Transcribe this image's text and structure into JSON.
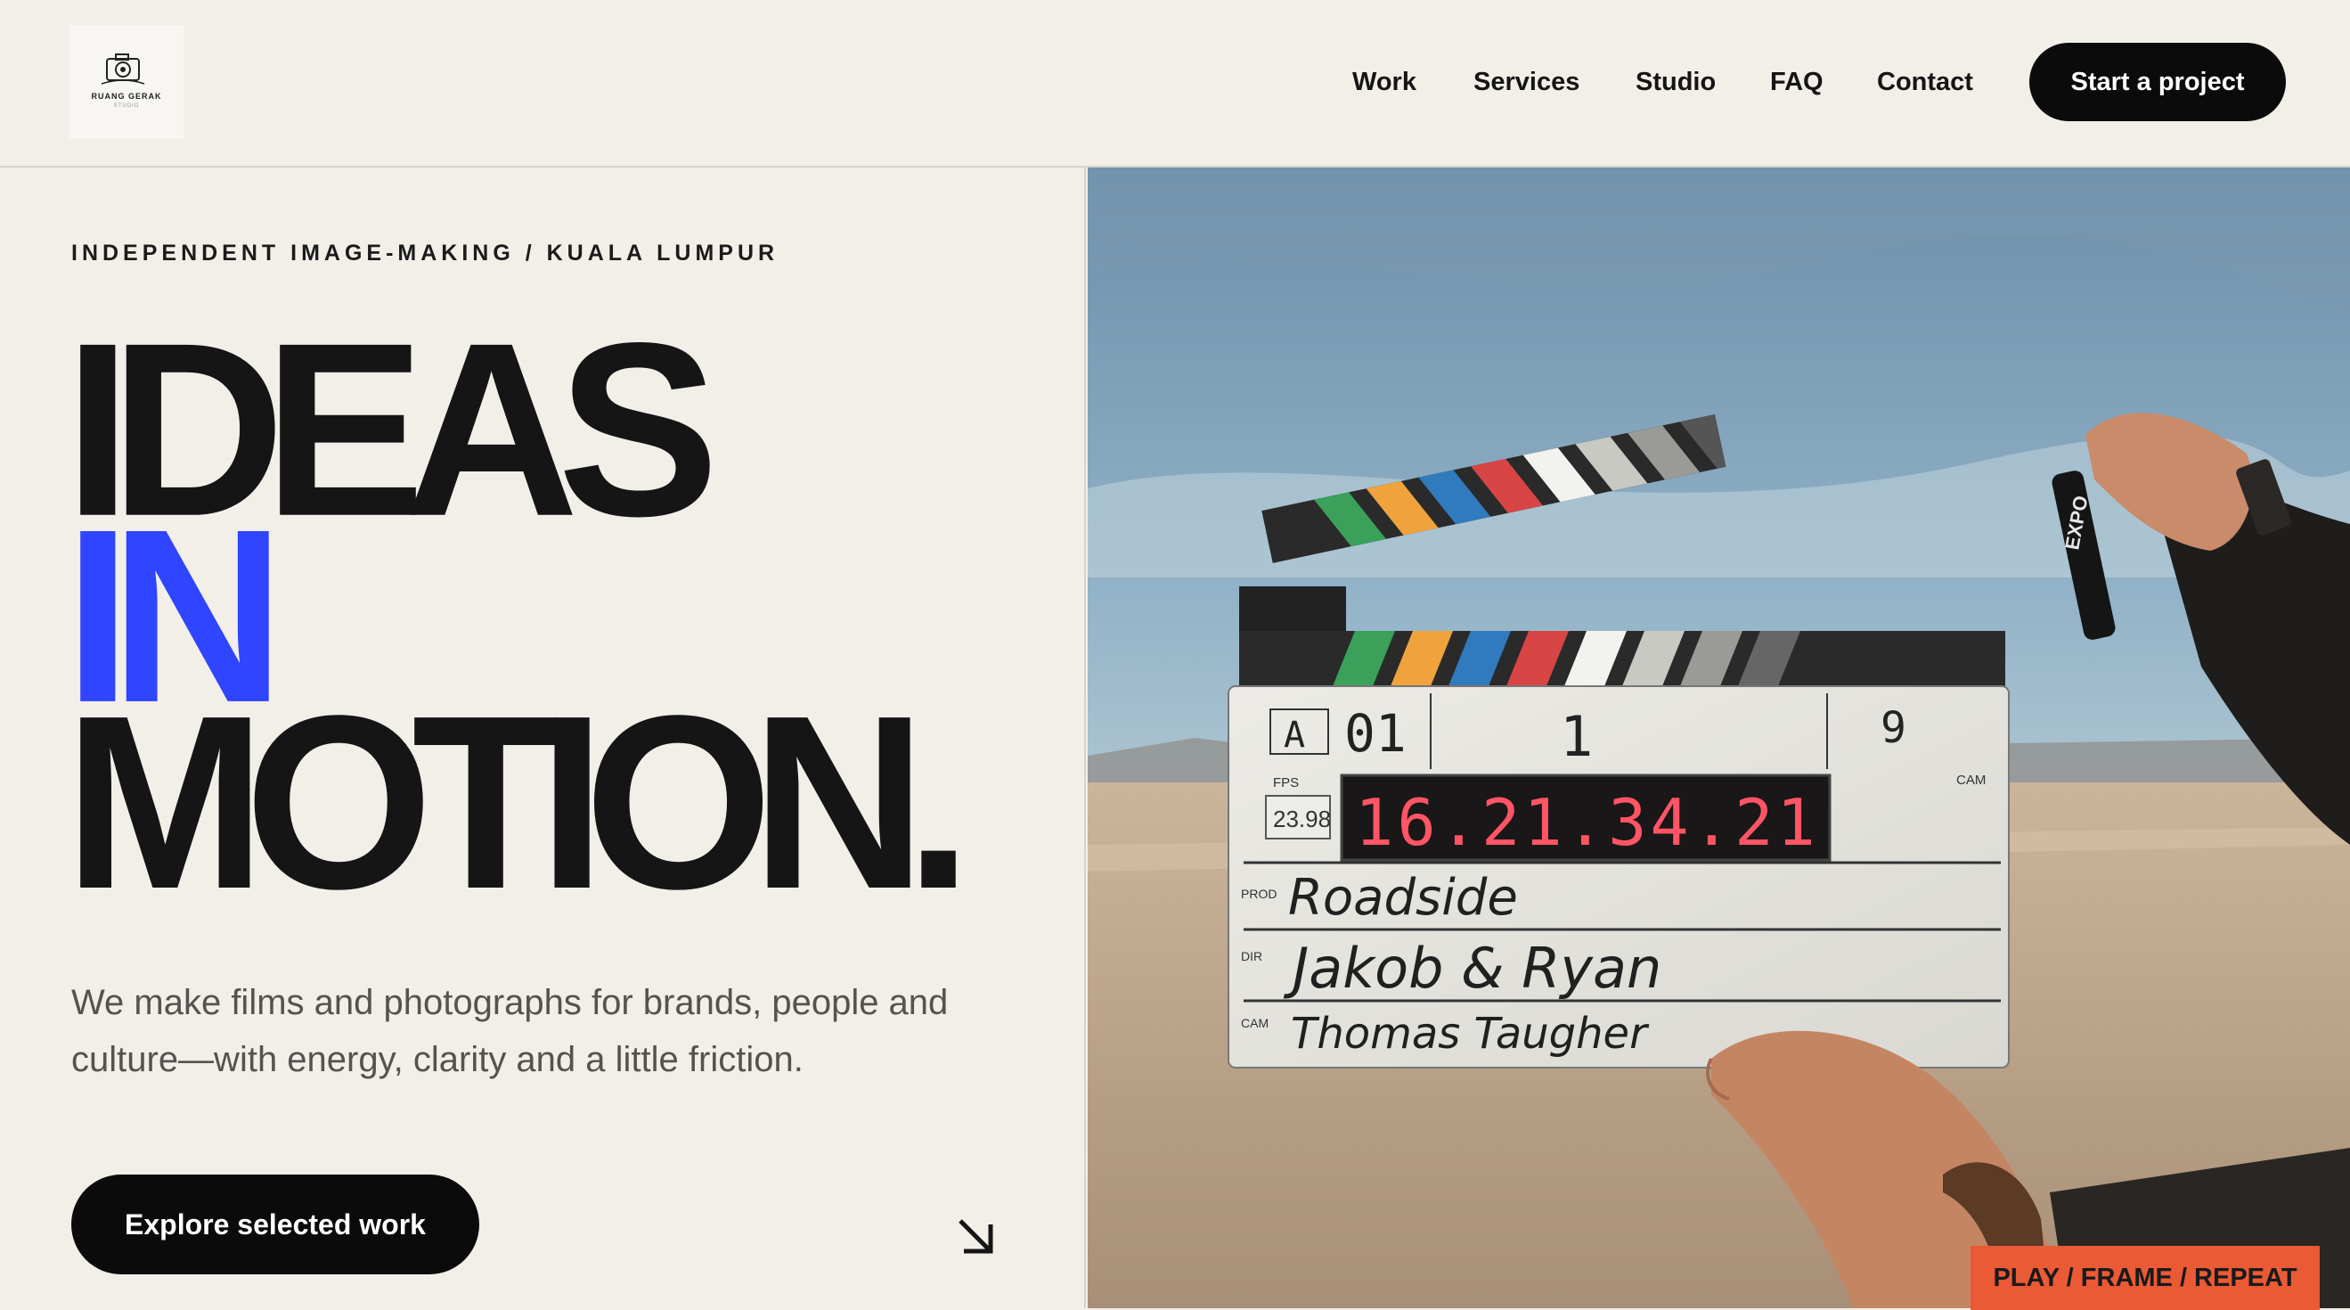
{
  "brand": {
    "logo_text": "RUANG GERAK",
    "logo_sub": "STUDIO"
  },
  "nav": {
    "items": [
      {
        "label": "Work"
      },
      {
        "label": "Services"
      },
      {
        "label": "Studio"
      },
      {
        "label": "FAQ"
      },
      {
        "label": "Contact"
      }
    ],
    "cta_label": "Start a project"
  },
  "hero": {
    "eyebrow": "INDEPENDENT IMAGE-MAKING / KUALA LUMPUR",
    "headline_1": "IDEAS",
    "headline_2": "IN",
    "headline_3": "MOTION.",
    "lede": "We make films and photographs for brands, people and culture—with energy, clarity and a little friction.",
    "explore_label": "Explore selected work",
    "badge": "PLAY / FRAME / REPEAT",
    "accent_color": "#2f45ff",
    "badge_color": "#ea5a35"
  },
  "slate": {
    "roll": "A",
    "scene_num": "01",
    "scene": "1",
    "take": "9",
    "fps_label": "FPS",
    "fps": "23.98",
    "timecode": "16.21.34.21",
    "cam_label": "CAM",
    "prod_label": "PROD",
    "dir_label": "DIR",
    "cam_row_label": "CAM",
    "prod": "Roadside",
    "dir": "Jakob & Ryan",
    "cam": "Thomas Taugher",
    "marker": "EXPO"
  }
}
